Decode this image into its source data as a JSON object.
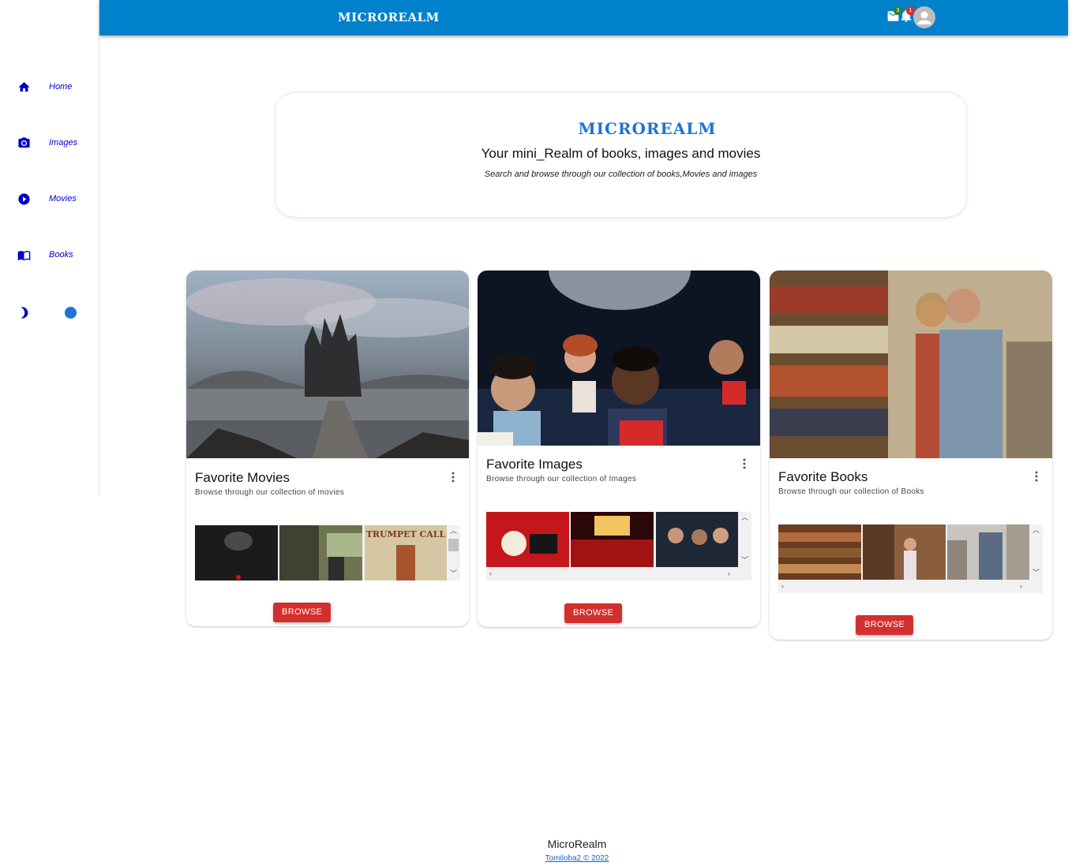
{
  "sidebar": {
    "items": [
      {
        "label": "Home",
        "icon": "home-icon"
      },
      {
        "label": "Images",
        "icon": "camera-icon"
      },
      {
        "label": "Movies",
        "icon": "play-circle-icon"
      },
      {
        "label": "Books",
        "icon": "menu-book-icon"
      }
    ],
    "theme_icon": "dark-mode-icon"
  },
  "appbar": {
    "title": "MICROREALM",
    "mail_count": "3",
    "notification_count": "1",
    "background_color": "#0081cb"
  },
  "hero": {
    "title": "MICROREALM",
    "subtitle": "Your mini_Realm of books, images and movies",
    "caption": "Search and browse through our collection of books,Movies and images"
  },
  "cards": [
    {
      "title": "Favorite Movies",
      "description": "Browse through our collection of movies",
      "button_label": "BROWSE"
    },
    {
      "title": "Favorite Images",
      "description": "Browse through our collection of Images",
      "button_label": "BROWSE"
    },
    {
      "title": "Favorite Books",
      "description": "Browse through our collection of Books",
      "button_label": "BROWSE"
    }
  ],
  "footer": {
    "name": "MicroRealm",
    "credit": "Tomiloba2 © 2022"
  },
  "colors": {
    "accent": "#1e74d4",
    "button": "#d32f2f",
    "nav_text": "#0000cc"
  }
}
